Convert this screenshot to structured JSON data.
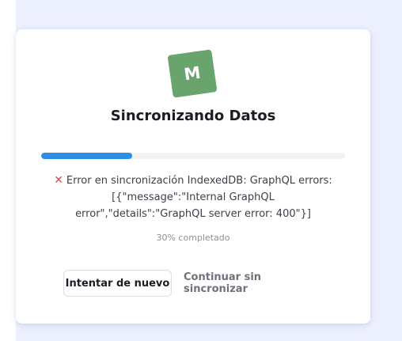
{
  "logo": {
    "letter": "M",
    "color": "#6aa46d"
  },
  "title": "Sincronizando Datos",
  "progress": {
    "percent": 30,
    "fill_color": "#2d8ee6",
    "label": "30% completado"
  },
  "error": {
    "icon": "cross-mark-icon",
    "icon_glyph": "✕",
    "message": "Error en sincronización IndexedDB: GraphQL errors: [{\"message\":\"Internal GraphQL error\",\"details\":\"GraphQL server error: 400\"}]"
  },
  "actions": {
    "retry_label": "Intentar de nuevo",
    "continue_label": "Continuar sin sincronizar"
  }
}
